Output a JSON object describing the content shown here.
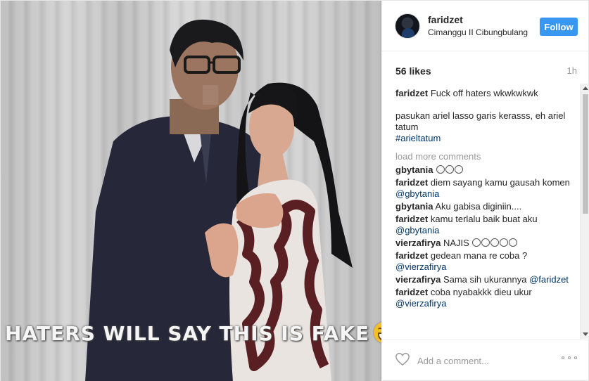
{
  "post": {
    "photo": {
      "overlay_text": "HATERS WILL SAY THIS IS FAKE",
      "overlay_emoji": "laughing-emoji"
    },
    "header": {
      "username": "faridzet",
      "location": "Cimanggu II Cibungbulang",
      "follow_label": "Follow"
    },
    "likes": "56 likes",
    "time": "1h",
    "caption": {
      "user": "faridzet",
      "line1": "Fuck off haters wkwkwkwk",
      "line2": "pasukan ariel lasso garis kerasss, eh ariel tatum",
      "hashtag": "#arieltatum"
    },
    "load_more": "load more comments",
    "comments": [
      {
        "user": "gbytania",
        "text": "",
        "mention": "",
        "emoji_count": 3
      },
      {
        "user": "faridzet",
        "text": "diem sayang kamu gausah komen ",
        "mention": "@gbytania"
      },
      {
        "user": "gbytania",
        "text": "Aku gabisa diginiin....",
        "mention": ""
      },
      {
        "user": "faridzet",
        "text": "kamu terlalu baik buat aku ",
        "mention": "@gbytania"
      },
      {
        "user": "vierzafirya",
        "text": "NAJIS ",
        "mention": "",
        "emoji_count": 5
      },
      {
        "user": "faridzet",
        "text": "gedean mana re coba ? ",
        "mention": "@vierzafirya"
      },
      {
        "user": "vierzafirya",
        "text": "Sama sih ukurannya ",
        "mention": "@faridzet"
      },
      {
        "user": "faridzet",
        "text": "coba nyabakkk dieu ukur ",
        "mention": "@vierzafirya"
      }
    ],
    "add_comment_placeholder": "Add a comment...",
    "colors": {
      "follow_button": "#3897f0",
      "link": "#003569",
      "muted": "#999999"
    }
  }
}
